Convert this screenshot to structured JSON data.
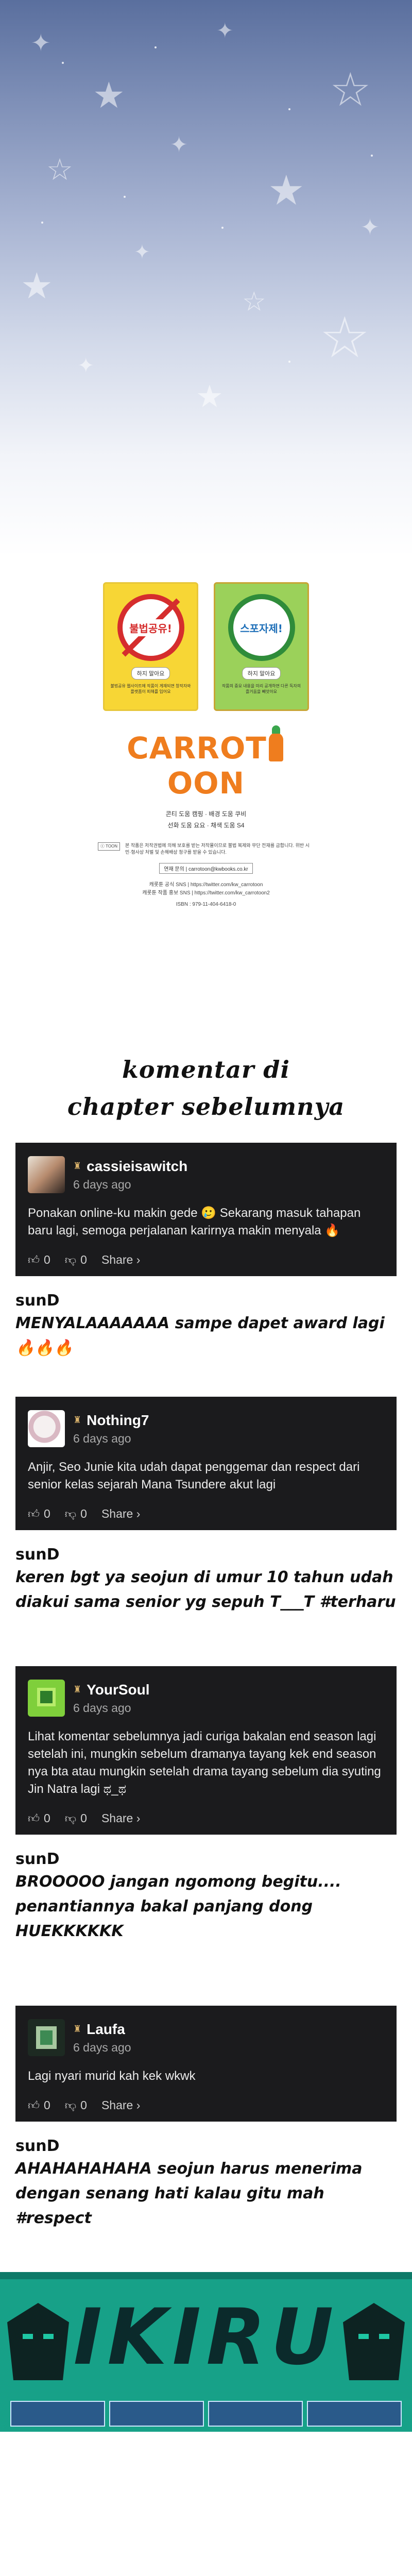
{
  "publisher": {
    "sign_left": {
      "title": "불법공유!",
      "pill": "하지 말아요",
      "note": "불법공유 웹사이트에 작품이 게재되면 창작자와 플랫폼이 피해를 입어요"
    },
    "sign_right": {
      "title": "스포자제!",
      "pill": "하지 말아요",
      "note": "작품의 중요 내용을 미리 공개하면 다른 독자의 즐거움을 빼앗아요"
    },
    "logo": "CARROT",
    "logo_end": "OON",
    "credit_line_1": "콘티 도움 캠핑 · 배경 도움 쿠비",
    "credit_line_2": "선화 도움 요요 · 채색 도움 S4",
    "legal_tag": "ⓒ TOON",
    "legal_text": "본 작품은 저작권법에 의해 보호를 받는 저작물이므로 불법 복제와 무단 전재를 금합니다. 위반 시 민·형사상 처벌 및 손해배상 청구를 받을 수 있습니다.",
    "contact": "연재 문의 | carrotoon@kwbooks.co.kr",
    "sns_1": "캐롯툰 공식 SNS | https://twitter.com/kw_carrotoon",
    "sns_2": "캐롯툰 작품 홍보 SNS | https://twitter.com/kw_carrotoon2",
    "isbn": "ISBN : 979-11-404-6418-0"
  },
  "section_title_1": "komentar di",
  "section_title_2": "chapter sebelumnya",
  "comments": [
    {
      "name": "cassieisawitch",
      "time": "6 days ago",
      "text": "Ponakan online-ku makin gede 🥲 Sekarang masuk tahapan baru lagi, semoga perjalanan karirnya makin menyala 🔥",
      "likes": "0",
      "dislikes": "0",
      "share": "Share ›",
      "reply_by": "sunD",
      "reply": "MENYALAAAAAAA sampe dapet award lagi 🔥🔥🔥"
    },
    {
      "name": "Nothing7",
      "time": "6 days ago",
      "text": "Anjir, Seo Junie kita udah dapat penggemar dan respect dari senior kelas sejarah Mana Tsundere akut lagi",
      "likes": "0",
      "dislikes": "0",
      "share": "Share ›",
      "reply_by": "sunD",
      "reply": "keren bgt ya seojun di umur 10 tahun udah diakui sama senior yg sepuh T___T #terharu"
    },
    {
      "name": "YourSoul",
      "time": "6 days ago",
      "text": "Lihat komentar sebelumnya jadi curiga bakalan end season lagi setelah ini, mungkin sebelum dramanya tayang kek end season nya bta atau mungkin setelah drama tayang sebelum dia syuting Jin Natra lagi ಥ_ಥ",
      "likes": "0",
      "dislikes": "0",
      "share": "Share ›",
      "reply_by": "sunD",
      "reply": "BROOOOO jangan ngomong begitu.... penantiannya bakal panjang dong HUEKKKKKK"
    },
    {
      "name": "Laufa",
      "time": "6 days ago",
      "text": "Lagi nyari murid kah kek wkwk",
      "likes": "0",
      "dislikes": "0",
      "share": "Share ›",
      "reply_by": "sunD",
      "reply": "AHAHAHAHAHA seojun harus menerima dengan senang hati kalau gitu mah #respect"
    }
  ],
  "banner": {
    "title": "IKIRU"
  },
  "colors": {
    "card_bg": "#1b1b1d",
    "carrot_orange": "#ef7d1e",
    "banner_teal": "#17a188"
  }
}
